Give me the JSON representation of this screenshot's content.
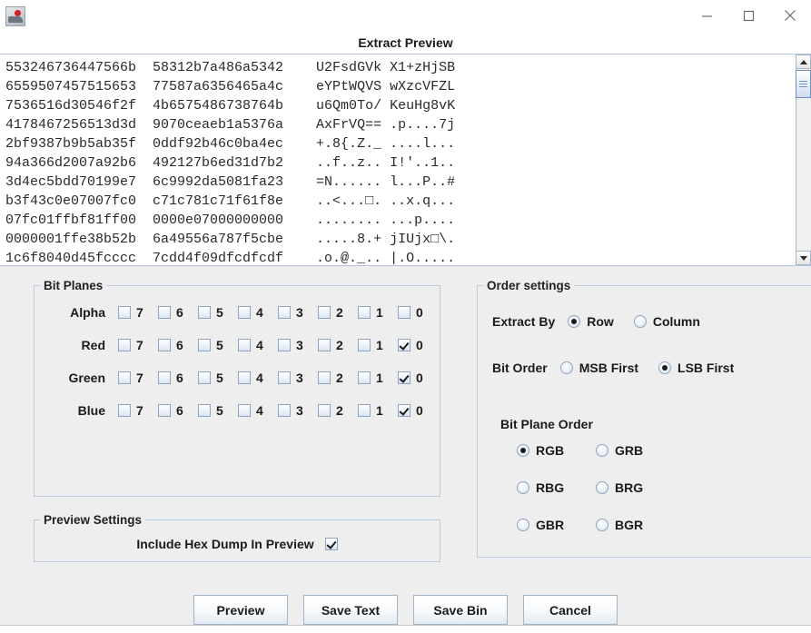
{
  "window": {
    "icon_name": "app-icon",
    "minimize_label": "minimize-icon",
    "maximize_label": "maximize-icon",
    "close_label": "close-icon"
  },
  "preview": {
    "title": "Extract Preview",
    "hex_lines": [
      {
        "hex_left": "553246736447566b",
        "hex_right": "58312b7a486a5342",
        "ascii_left": "U2FsdGVk",
        "ascii_right": "X1+zHjSB"
      },
      {
        "hex_left": "6559507457515653",
        "hex_right": "77587a6356465a4c",
        "ascii_left": "eYPtWQVS",
        "ascii_right": "wXzcVFZL"
      },
      {
        "hex_left": "7536516d30546f2f",
        "hex_right": "4b6575486738764b",
        "ascii_left": "u6Qm0To/",
        "ascii_right": "KeuHg8vK"
      },
      {
        "hex_left": "4178467256513d3d",
        "hex_right": "9070ceaeb1a5376a",
        "ascii_left": "AxFrVQ==",
        "ascii_right": ".p....7j"
      },
      {
        "hex_left": "2bf9387b9b5ab35f",
        "hex_right": "0ddf92b46c0ba4ec",
        "ascii_left": "+.8{.Z._",
        "ascii_right": "....l..."
      },
      {
        "hex_left": "94a366d2007a92b6",
        "hex_right": "492127b6ed31d7b2",
        "ascii_left": "..f..z..",
        "ascii_right": "I!'..1.."
      },
      {
        "hex_left": "3d4ec5bdd70199e7",
        "hex_right": "6c9992da5081fa23",
        "ascii_left": "=N......",
        "ascii_right": "l...P..#"
      },
      {
        "hex_left": "b3f43c0e07007fc0",
        "hex_right": "c71c781c71f61f8e",
        "ascii_left": "..<...□.",
        "ascii_right": "..x.q..."
      },
      {
        "hex_left": "07fc01ffbf81ff00",
        "hex_right": "0000e07000000000",
        "ascii_left": "........",
        "ascii_right": "...p...."
      },
      {
        "hex_left": "0000001ffe38b52b",
        "hex_right": "6a49556a787f5cbe",
        "ascii_left": ".....8.+",
        "ascii_right": "jIUjx□\\."
      },
      {
        "hex_left": "1c6f8040d45fcccc",
        "hex_right": "7cdd4f09dfcdfcdf",
        "ascii_left": ".o.@._..",
        "ascii_right": "|.O....."
      }
    ],
    "scrollbar": {
      "up_arrow": "scroll-up-arrow",
      "down_arrow": "scroll-down-arrow",
      "thumb": "scroll-thumb"
    }
  },
  "bit_planes": {
    "legend": "Bit Planes",
    "bit_labels": [
      "7",
      "6",
      "5",
      "4",
      "3",
      "2",
      "1",
      "0"
    ],
    "rows": [
      {
        "label": "Alpha",
        "checked": [
          false,
          false,
          false,
          false,
          false,
          false,
          false,
          false
        ]
      },
      {
        "label": "Red",
        "checked": [
          false,
          false,
          false,
          false,
          false,
          false,
          false,
          true
        ]
      },
      {
        "label": "Green",
        "checked": [
          false,
          false,
          false,
          false,
          false,
          false,
          false,
          true
        ]
      },
      {
        "label": "Blue",
        "checked": [
          false,
          false,
          false,
          false,
          false,
          false,
          false,
          true
        ]
      }
    ]
  },
  "preview_settings": {
    "legend": "Preview Settings",
    "include_hex_dump_label": "Include Hex Dump In Preview",
    "include_hex_dump_checked": true
  },
  "order_settings": {
    "legend": "Order settings",
    "extract_by": {
      "label": "Extract By",
      "options": [
        {
          "label": "Row",
          "selected": true
        },
        {
          "label": "Column",
          "selected": false
        }
      ]
    },
    "bit_order": {
      "label": "Bit Order",
      "options": [
        {
          "label": "MSB First",
          "selected": false
        },
        {
          "label": "LSB First",
          "selected": true
        }
      ]
    },
    "bit_plane_order": {
      "label": "Bit Plane Order",
      "options": [
        {
          "label": "RGB",
          "selected": true
        },
        {
          "label": "GRB",
          "selected": false
        },
        {
          "label": "RBG",
          "selected": false
        },
        {
          "label": "BRG",
          "selected": false
        },
        {
          "label": "GBR",
          "selected": false
        },
        {
          "label": "BGR",
          "selected": false
        }
      ]
    }
  },
  "buttons": [
    {
      "label": "Preview"
    },
    {
      "label": "Save Text"
    },
    {
      "label": "Save Bin"
    },
    {
      "label": "Cancel"
    }
  ],
  "colors": {
    "panel_bg": "#eeeeee",
    "group_border": "#b9cbe0",
    "text": "#1b1b1b",
    "accent": "#6f8fbf"
  }
}
